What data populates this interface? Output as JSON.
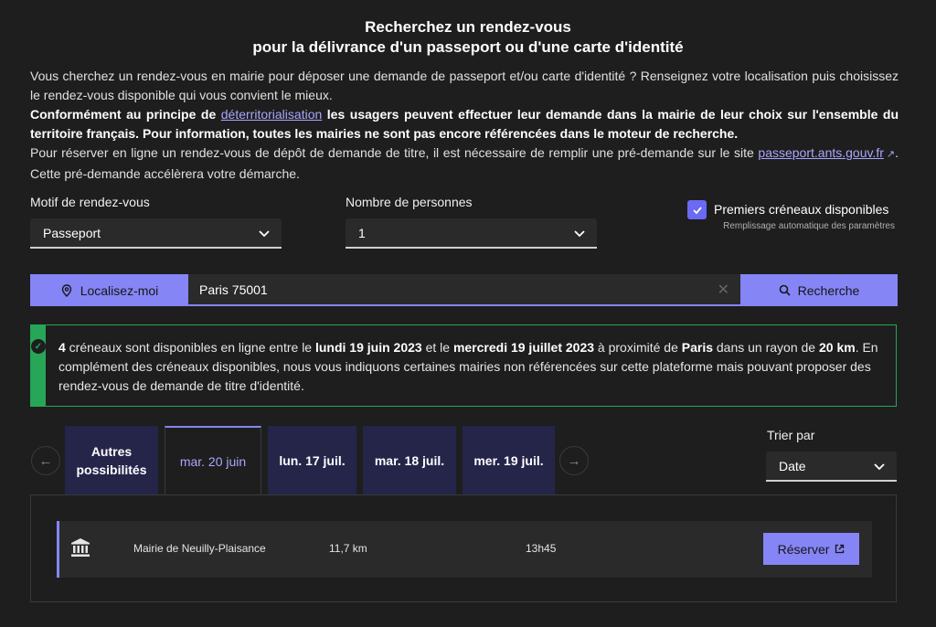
{
  "header": {
    "title_line1": "Recherchez un rendez-vous",
    "title_line2": "pour la délivrance d'un passeport ou d'une carte d'identité"
  },
  "intro": {
    "p1": "Vous cherchez un rendez-vous en mairie pour déposer une demande de passeport et/ou carte d'identité ? Renseignez votre localisation puis choisissez le rendez-vous disponible qui vous convient le mieux.",
    "p2_before": "Conformément au principe de ",
    "p2_link": "déterritorialisation",
    "p2_after": " les usagers peuvent effectuer leur demande dans la mairie de leur choix sur l'ensemble du territoire français. Pour information, toutes les mairies ne sont pas encore référencées dans le moteur de recherche.",
    "p3_before": "Pour réserver en ligne un rendez-vous de dépôt de demande de titre, il est nécessaire de remplir une pré-demande sur le site ",
    "p3_link": "passeport.ants.gouv.fr",
    "p3_after": ". Cette pré-demande accélèrera votre démarche."
  },
  "form": {
    "motif_label": "Motif de rendez-vous",
    "motif_value": "Passeport",
    "nombre_label": "Nombre de personnes",
    "nombre_value": "1",
    "premiers_label": "Premiers créneaux disponibles",
    "premiers_hint": "Remplissage automatique des paramètres",
    "premiers_checked": true
  },
  "search": {
    "locate_label": "Localisez-moi",
    "input_value": "Paris 75001",
    "search_label": "Recherche"
  },
  "alert": {
    "count": "4",
    "t1": " créneaux sont disponibles en ligne entre le ",
    "date_start": "lundi 19 juin 2023",
    "t2": " et le ",
    "date_end": "mercredi 19 juillet 2023",
    "t3": " à proximité de ",
    "city": "Paris",
    "t4": " dans un rayon de ",
    "radius": "20 km",
    "t5": ". En complément des créneaux disponibles, nous vous indiquons certaines mairies non référencées sur cette plateforme mais pouvant proposer des rendez-vous de demande de titre d'identité."
  },
  "tabs": [
    {
      "label_l1": "Autres",
      "label_l2": "possibilités"
    },
    {
      "label": "mar. 20 juin"
    },
    {
      "label": "lun. 17 juil."
    },
    {
      "label": "mar. 18 juil."
    },
    {
      "label": "mer. 19 juil."
    }
  ],
  "sort": {
    "label": "Trier par",
    "value": "Date"
  },
  "results": [
    {
      "name": "Mairie de Neuilly-Plaisance",
      "distance": "11,7 km",
      "time": "13h45",
      "button": "Réserver"
    }
  ],
  "colors": {
    "accent": "#8585f6",
    "success": "#27a658",
    "background": "#1e1e1e"
  }
}
